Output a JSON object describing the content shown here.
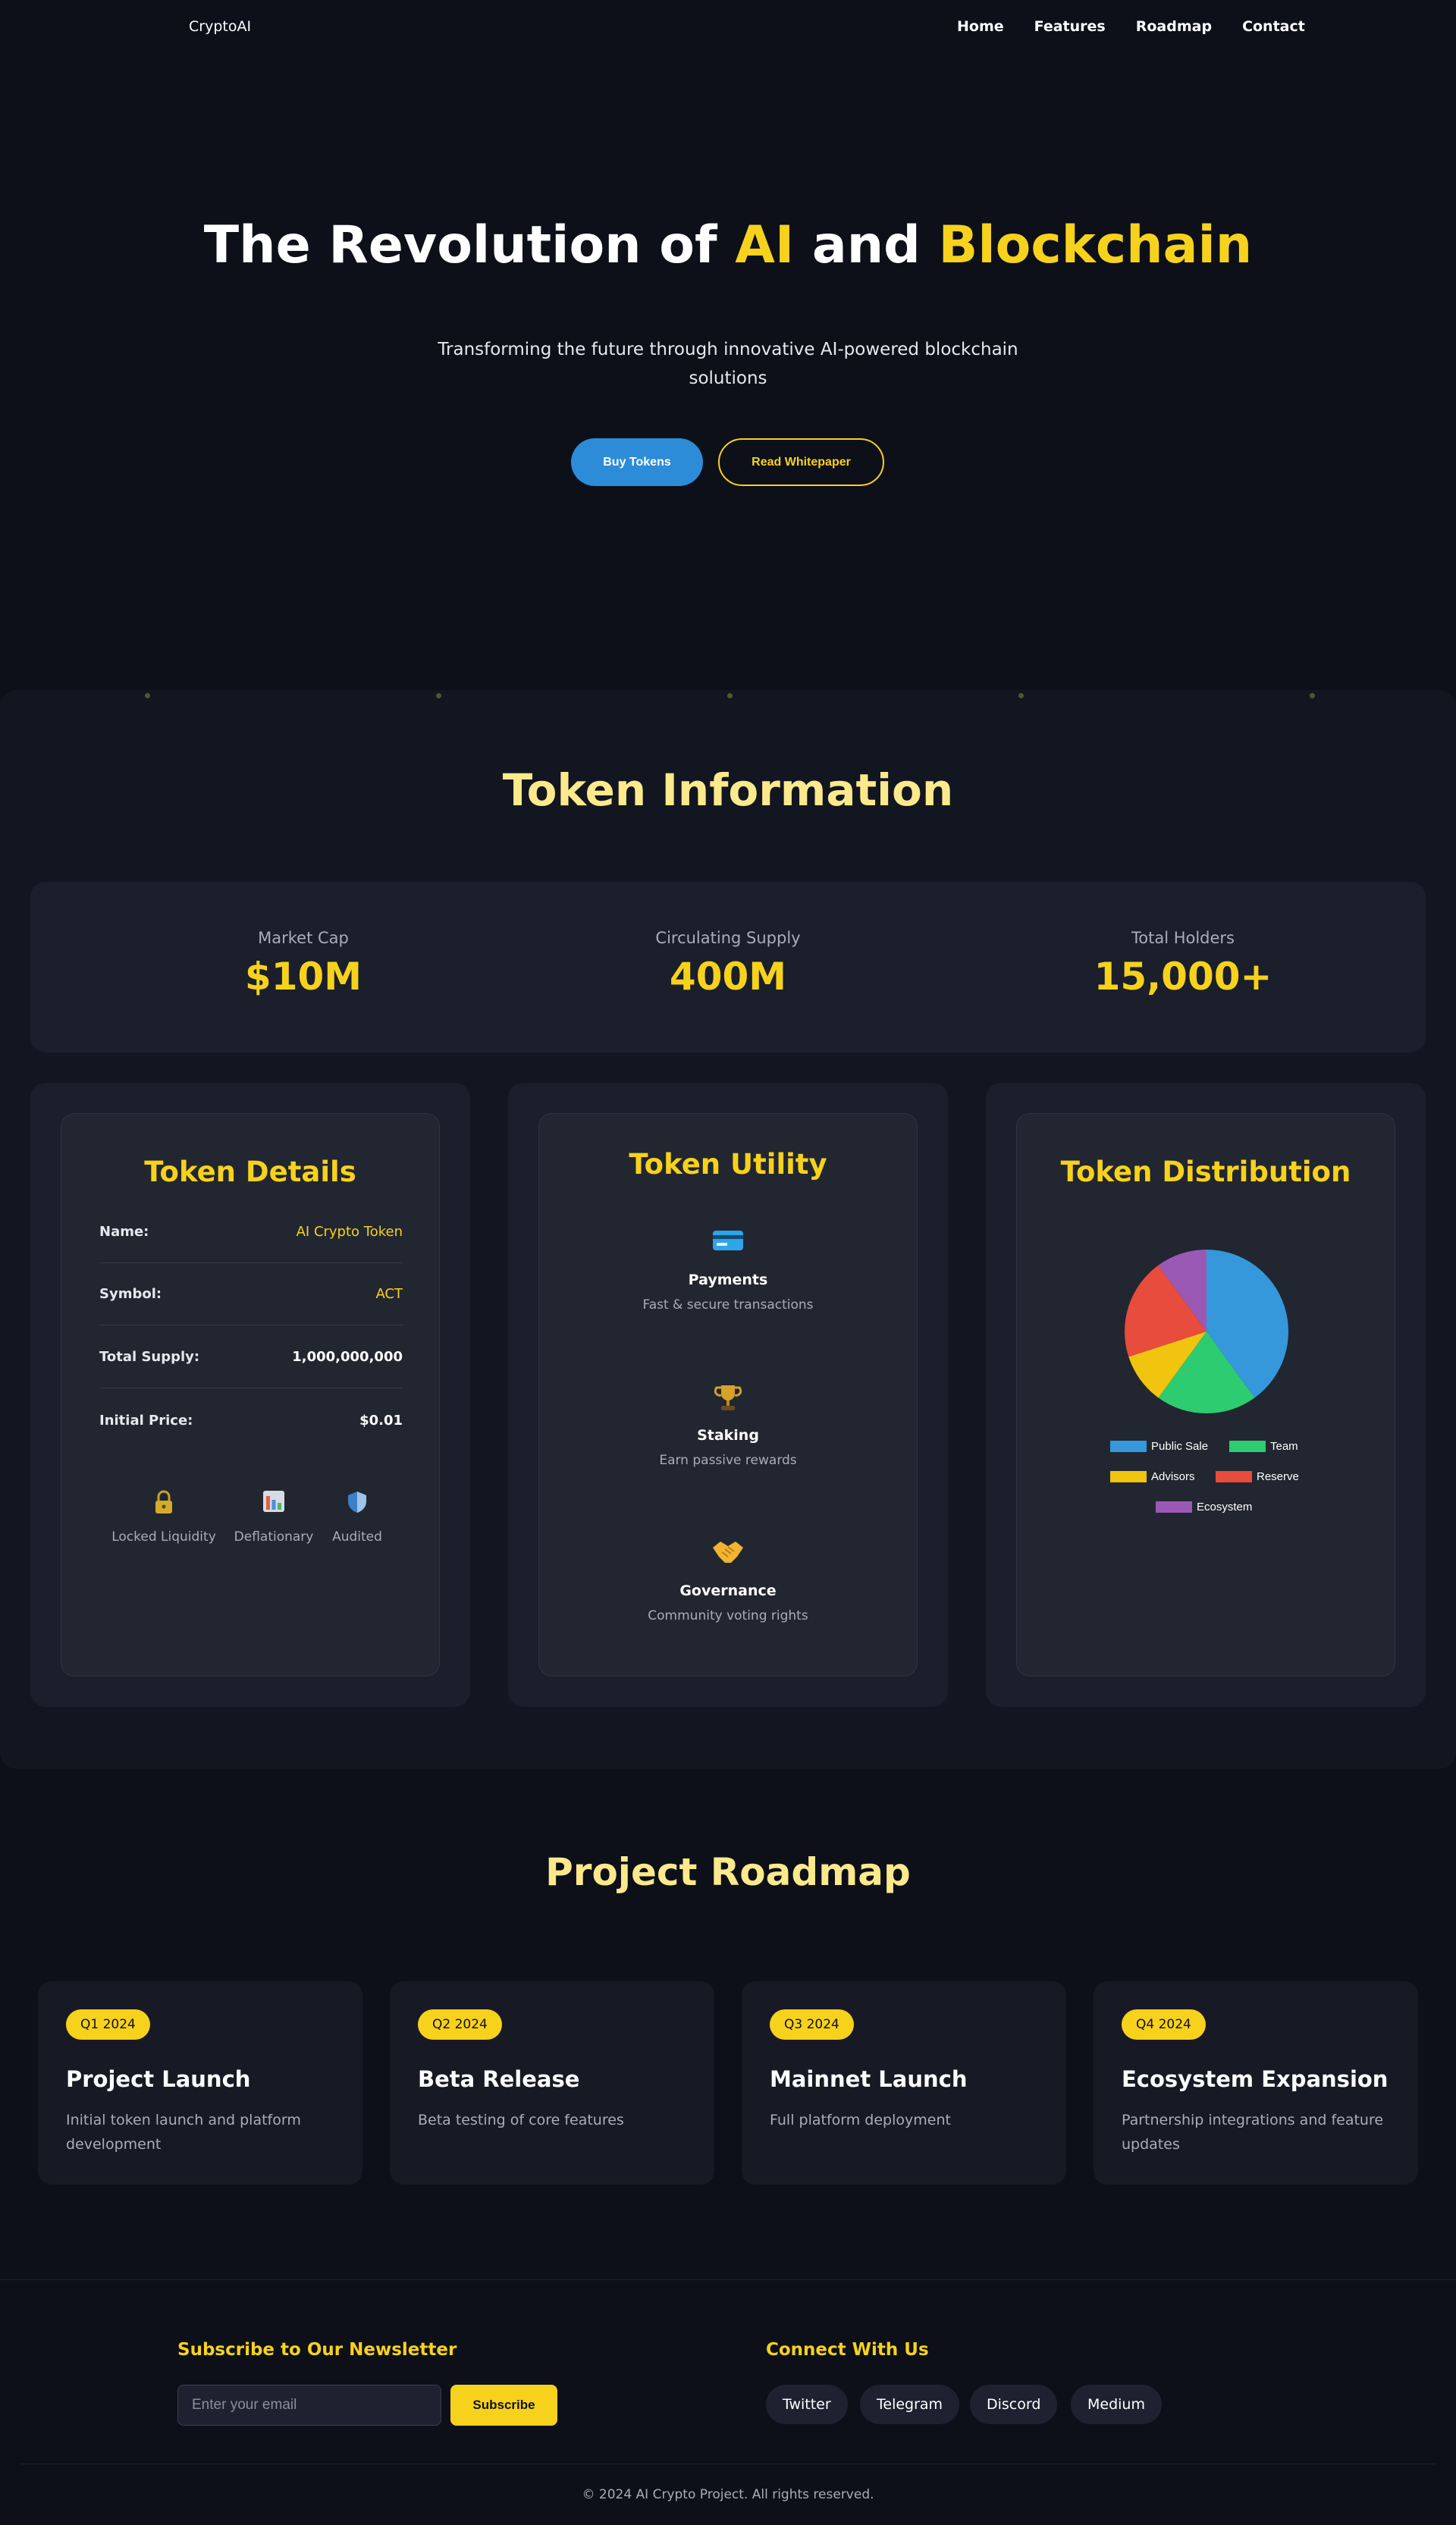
{
  "nav": {
    "brand": "CryptoAI",
    "links": [
      "Home",
      "Features",
      "Roadmap",
      "Contact"
    ]
  },
  "hero": {
    "title_part1": "The Revolution of ",
    "title_ai": "AI",
    "title_part2": " and ",
    "title_blockchain": "Blockchain",
    "subtitle": "Transforming the future through innovative AI-powered blockchain solutions",
    "buy_label": "Buy Tokens",
    "whitepaper_label": "Read Whitepaper"
  },
  "token_info": {
    "title": "Token Information",
    "stats": [
      {
        "label": "Market Cap",
        "value": "$10M"
      },
      {
        "label": "Circulating Supply",
        "value": "400M"
      },
      {
        "label": "Total Holders",
        "value": "15,000+"
      }
    ],
    "details": {
      "title": "Token Details",
      "rows": [
        {
          "key": "Name:",
          "value": "AI Crypto Token"
        },
        {
          "key": "Symbol:",
          "value": "ACT"
        },
        {
          "key": "Total Supply:",
          "value": "1,000,000,000"
        },
        {
          "key": "Initial Price:",
          "value": "$0.01"
        }
      ],
      "features": [
        {
          "icon": "lock-icon",
          "label": "Locked Liquidity"
        },
        {
          "icon": "chart-icon",
          "label": "Deflationary"
        },
        {
          "icon": "shield-icon",
          "label": "Audited"
        }
      ]
    },
    "utility": {
      "title": "Token Utility",
      "items": [
        {
          "icon": "credit-card-icon",
          "name": "Payments",
          "desc": "Fast & secure transactions"
        },
        {
          "icon": "trophy-icon",
          "name": "Staking",
          "desc": "Earn passive rewards"
        },
        {
          "icon": "handshake-icon",
          "name": "Governance",
          "desc": "Community voting rights"
        }
      ]
    },
    "distribution": {
      "title": "Token Distribution"
    }
  },
  "chart_data": {
    "type": "pie",
    "title": "",
    "categories": [
      "Public Sale",
      "Team",
      "Advisors",
      "Reserve",
      "Ecosystem"
    ],
    "values": [
      40,
      20,
      10,
      20,
      10
    ],
    "colors": [
      "#3498db",
      "#2ecc71",
      "#f1c40f",
      "#e74c3c",
      "#9b59b6"
    ],
    "legend_position": "bottom"
  },
  "roadmap": {
    "title": "Project Roadmap",
    "items": [
      {
        "quarter": "Q1 2024",
        "title": "Project Launch",
        "desc": "Initial token launch and platform development"
      },
      {
        "quarter": "Q2 2024",
        "title": "Beta Release",
        "desc": "Beta testing of core features"
      },
      {
        "quarter": "Q3 2024",
        "title": "Mainnet Launch",
        "desc": "Full platform deployment"
      },
      {
        "quarter": "Q4 2024",
        "title": "Ecosystem Expansion",
        "desc": "Partnership integrations and feature updates"
      }
    ]
  },
  "footer": {
    "newsletter_title": "Subscribe to Our Newsletter",
    "email_placeholder": "Enter your email",
    "subscribe_label": "Subscribe",
    "connect_title": "Connect With Us",
    "socials": [
      "Twitter",
      "Telegram",
      "Discord",
      "Medium"
    ],
    "copyright": "© 2024 AI Crypto Project. All rights reserved."
  },
  "colors": {
    "background": "#0d1019",
    "accent": "#f7d21c",
    "primary_button": "#2d8cd8",
    "muted_text": "#a9adb8"
  }
}
